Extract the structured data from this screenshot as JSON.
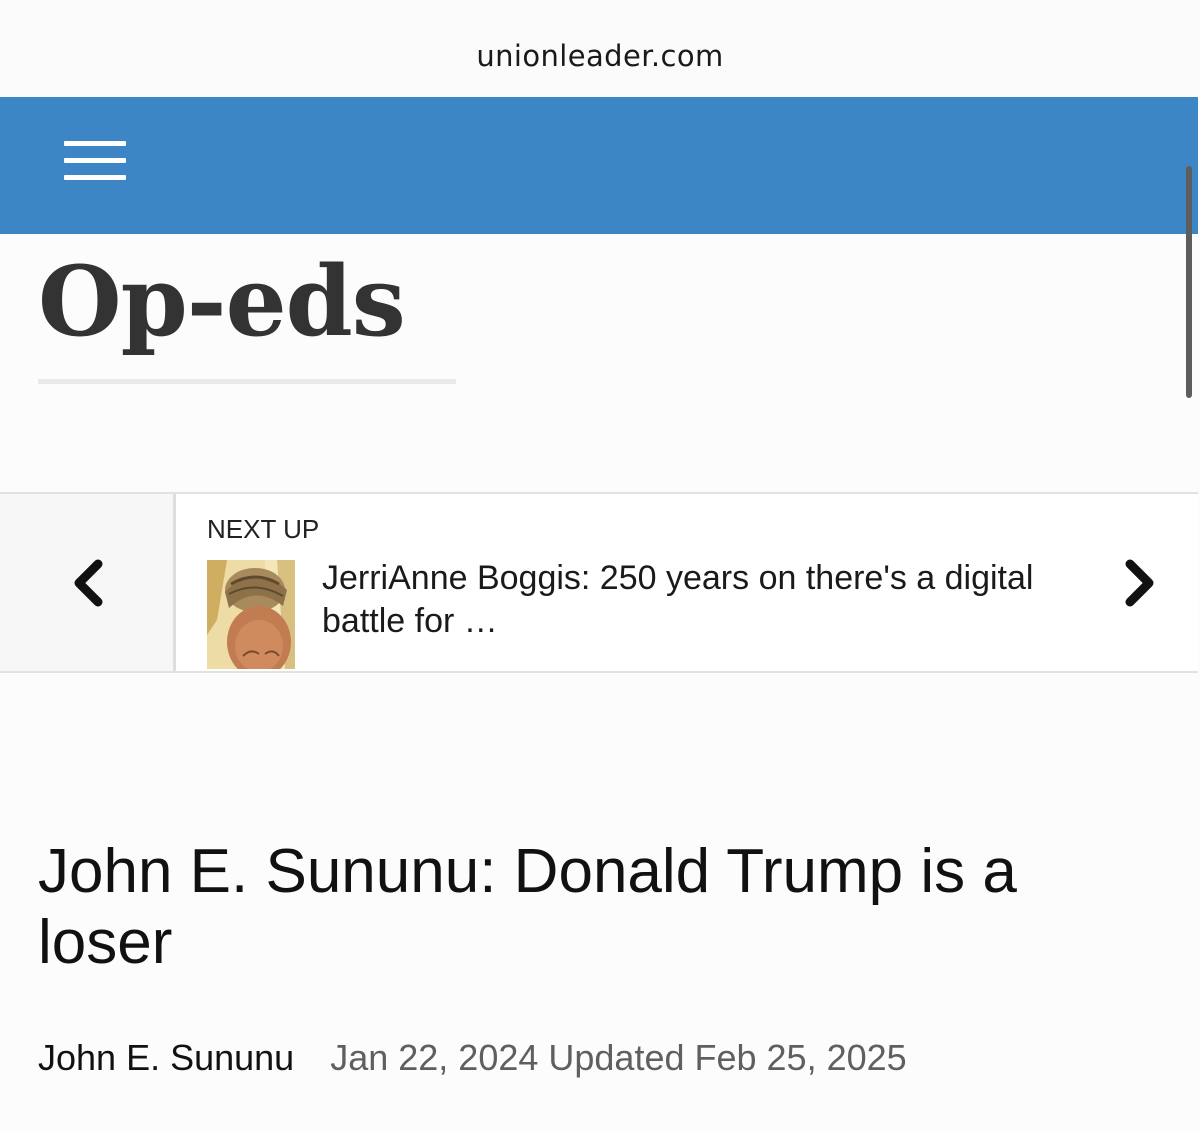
{
  "browser": {
    "url": "unionleader.com"
  },
  "header": {
    "menu_icon": "hamburger-menu-icon",
    "background_color": "#3d86c6"
  },
  "section": {
    "title": "Op-eds"
  },
  "next_up": {
    "label": "NEXT UP",
    "headline": "JerriAnne Boggis: 250 years on there's a digital battle for …",
    "prev_icon": "chevron-left-icon",
    "next_icon": "chevron-right-icon"
  },
  "article": {
    "title": "John E. Sununu: Donald Trump is a loser",
    "author": "John E. Sununu",
    "dates": "Jan 22, 2024 Updated Feb 25, 2025"
  }
}
